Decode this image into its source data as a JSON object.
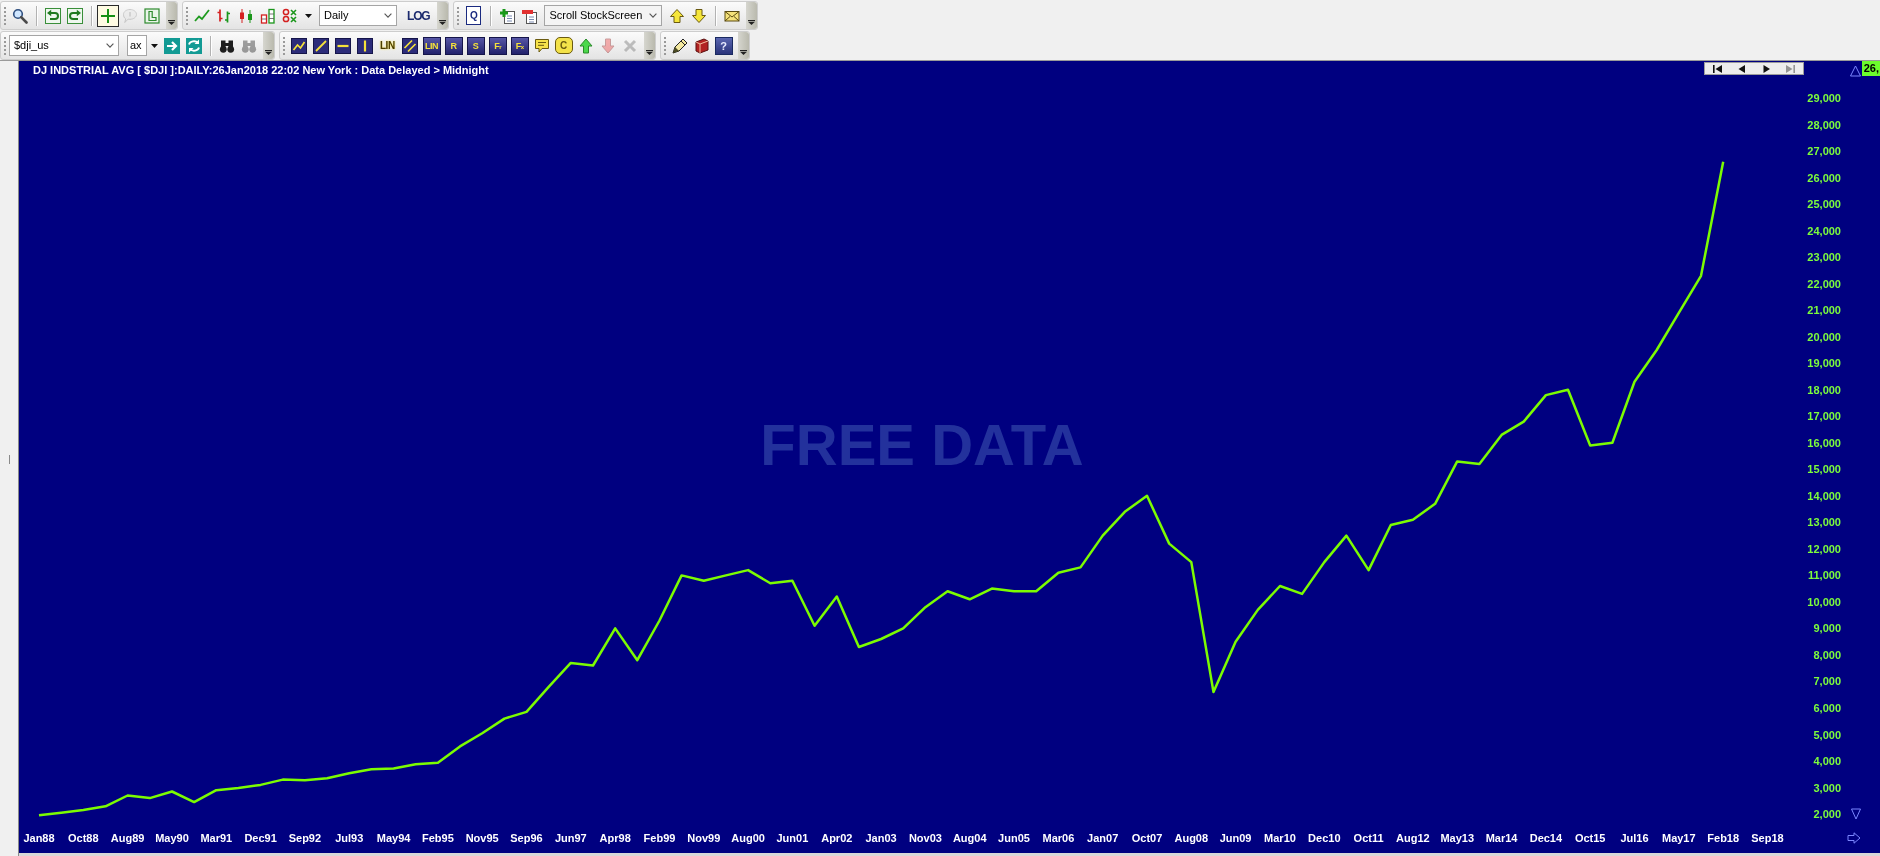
{
  "toolbar_rows": [
    [
      {
        "items": [
          {
            "kind": "icon",
            "pressed": false,
            "disabled": false
          },
          {
            "kind": "separator"
          },
          {
            "kind": "icon",
            "pressed": false,
            "disabled": false
          },
          {
            "kind": "icon",
            "pressed": false,
            "disabled": false
          },
          {
            "kind": "separator"
          },
          {
            "kind": "icon",
            "pressed": true,
            "disabled": false
          },
          {
            "kind": "icon",
            "pressed": false,
            "disabled": true
          },
          {
            "kind": "icon",
            "pressed": false,
            "disabled": false
          }
        ]
      },
      {
        "items": [
          {
            "kind": "icon"
          },
          {
            "kind": "icon"
          },
          {
            "kind": "icon"
          },
          {
            "kind": "icon"
          },
          {
            "kind": "icon"
          },
          {
            "kind": "arrow"
          },
          {
            "kind": "select",
            "value": "Daily"
          },
          {
            "kind": "label",
            "label": "LOG"
          }
        ]
      },
      {
        "items": [
          {
            "kind": "page",
            "label": "Q"
          },
          {
            "kind": "separator"
          },
          {
            "kind": "icon"
          },
          {
            "kind": "icon"
          },
          {
            "kind": "select",
            "value": "Scroll StockScreen"
          },
          {
            "kind": "icon"
          },
          {
            "kind": "icon"
          },
          {
            "kind": "separator"
          },
          {
            "kind": "icon"
          }
        ]
      }
    ],
    [
      {
        "items": [
          {
            "kind": "select",
            "value": "$dji_us"
          },
          {
            "kind": "input",
            "value": "ax"
          },
          {
            "kind": "arrow"
          },
          {
            "kind": "icon",
            "disabled": false
          },
          {
            "kind": "icon",
            "disabled": false
          },
          {
            "kind": "separator"
          },
          {
            "kind": "icon",
            "disabled": false
          },
          {
            "kind": "icon",
            "disabled": true
          }
        ]
      },
      {
        "items": [
          {
            "kind": "icon",
            "disabled": false
          },
          {
            "kind": "icon",
            "disabled": false
          },
          {
            "kind": "icon",
            "disabled": false
          },
          {
            "kind": "icon",
            "disabled": false
          },
          {
            "kind": "glyph",
            "label": "LIN",
            "disabled": false
          },
          {
            "kind": "icon",
            "disabled": false
          },
          {
            "kind": "tile",
            "label": "LIN",
            "disabled": false
          },
          {
            "kind": "tile",
            "label": "R",
            "disabled": false
          },
          {
            "kind": "tile",
            "label": "S",
            "disabled": false
          },
          {
            "kind": "tile",
            "label": "F$_{r}$",
            "disabled": false
          },
          {
            "kind": "tile",
            "label": "F$_{x}$",
            "disabled": false
          },
          {
            "kind": "icon",
            "disabled": false
          },
          {
            "kind": "bubble",
            "label": "C",
            "disabled": false
          },
          {
            "kind": "icon",
            "disabled": false
          },
          {
            "kind": "icon",
            "disabled": true
          },
          {
            "kind": "icon",
            "disabled": true
          }
        ]
      },
      {
        "items": [
          {
            "kind": "icon"
          },
          {
            "kind": "icon"
          },
          {
            "kind": "help",
            "label": "?"
          }
        ]
      }
    ]
  ],
  "chart": {
    "navigation_buttons": [
      {
        "disabled": false
      },
      {
        "disabled": false
      },
      {
        "disabled": false
      },
      {
        "disabled": true
      }
    ],
    "price_tag": "26,",
    "watermark": "FREE DATA",
    "chart_data": {
      "type": "line",
      "title": "DJ INDSTRIAL AVG [ $DJI ]:DAILY:26Jan2018 22:02 New York : Data Delayed > Midnight",
      "categories": [
        "Jan88",
        null,
        "Oct88",
        null,
        "Aug89",
        null,
        "May90",
        null,
        "Mar91",
        null,
        "Dec91",
        null,
        "Sep92",
        null,
        "Jul93",
        null,
        "May94",
        null,
        "Feb95",
        null,
        "Nov95",
        null,
        "Sep96",
        null,
        "Jun97",
        null,
        "Apr98",
        null,
        "Feb99",
        null,
        "Nov99",
        null,
        "Aug00",
        null,
        "Jun01",
        null,
        "Apr02",
        null,
        "Jan03",
        null,
        "Nov03",
        null,
        "Aug04",
        null,
        "Jun05",
        null,
        "Mar06",
        null,
        "Jan07",
        null,
        "Oct07",
        null,
        "Aug08",
        null,
        "Jun09",
        null,
        "Mar10",
        null,
        "Dec10",
        null,
        "Oct11",
        null,
        "Aug12",
        null,
        "May13",
        null,
        "Mar14",
        null,
        "Dec14",
        null,
        "Oct15",
        null,
        "Jul16",
        null,
        "May17",
        null,
        "Feb18",
        null,
        "Sep18"
      ],
      "series": [
        {
          "color": "#7cfc00",
          "values": [
            1950,
            2050,
            2150,
            2290,
            2700,
            2600,
            2850,
            2450,
            2900,
            2980,
            3100,
            3300,
            3270,
            3350,
            3540,
            3690,
            3720,
            3880,
            3930,
            4550,
            5050,
            5600,
            5850,
            6800,
            7700,
            7600,
            9000,
            7800,
            9300,
            11000,
            10800,
            11000,
            11200,
            10700,
            10800,
            9100,
            10200,
            8300,
            8600,
            9000,
            9800,
            10400,
            10100,
            10500,
            10400,
            10400,
            11100,
            11300,
            12500,
            13400,
            14000,
            12200,
            11500,
            6600,
            8500,
            9700,
            10600,
            10300,
            11500,
            12500,
            11200,
            12900,
            13100,
            13700,
            15300,
            15200,
            16300,
            16800,
            17800,
            18000,
            15900,
            16000,
            18300,
            19500,
            20900,
            22300,
            26600,
            null,
            null
          ]
        }
      ],
      "ylim": [
        530,
        30400
      ],
      "yticks": [
        {
          "value": 2000,
          "label": "2,000"
        },
        {
          "value": 3000,
          "label": "3,000"
        },
        {
          "value": 4000,
          "label": "4,000"
        },
        {
          "value": 5000,
          "label": "5,000"
        },
        {
          "value": 6000,
          "label": "6,000"
        },
        {
          "value": 7000,
          "label": "7,000"
        },
        {
          "value": 8000,
          "label": "8,000"
        },
        {
          "value": 9000,
          "label": "9,000"
        },
        {
          "value": 10000,
          "label": "10,000"
        },
        {
          "value": 11000,
          "label": "11,000"
        },
        {
          "value": 12000,
          "label": "12,000"
        },
        {
          "value": 13000,
          "label": "13,000"
        },
        {
          "value": 14000,
          "label": "14,000"
        },
        {
          "value": 15000,
          "label": "15,000"
        },
        {
          "value": 16000,
          "label": "16,000"
        },
        {
          "value": 17000,
          "label": "17,000"
        },
        {
          "value": 18000,
          "label": "18,000"
        },
        {
          "value": 19000,
          "label": "19,000"
        },
        {
          "value": 20000,
          "label": "20,000"
        },
        {
          "value": 21000,
          "label": "21,000"
        },
        {
          "value": 22000,
          "label": "22,000"
        },
        {
          "value": 23000,
          "label": "23,000"
        },
        {
          "value": 24000,
          "label": "24,000"
        },
        {
          "value": 25000,
          "label": "25,000"
        },
        {
          "value": 26000,
          "label": "26,000"
        },
        {
          "value": 27000,
          "label": "27,000"
        },
        {
          "value": 28000,
          "label": "28,000"
        },
        {
          "value": 29000,
          "label": "29,000"
        }
      ]
    }
  }
}
